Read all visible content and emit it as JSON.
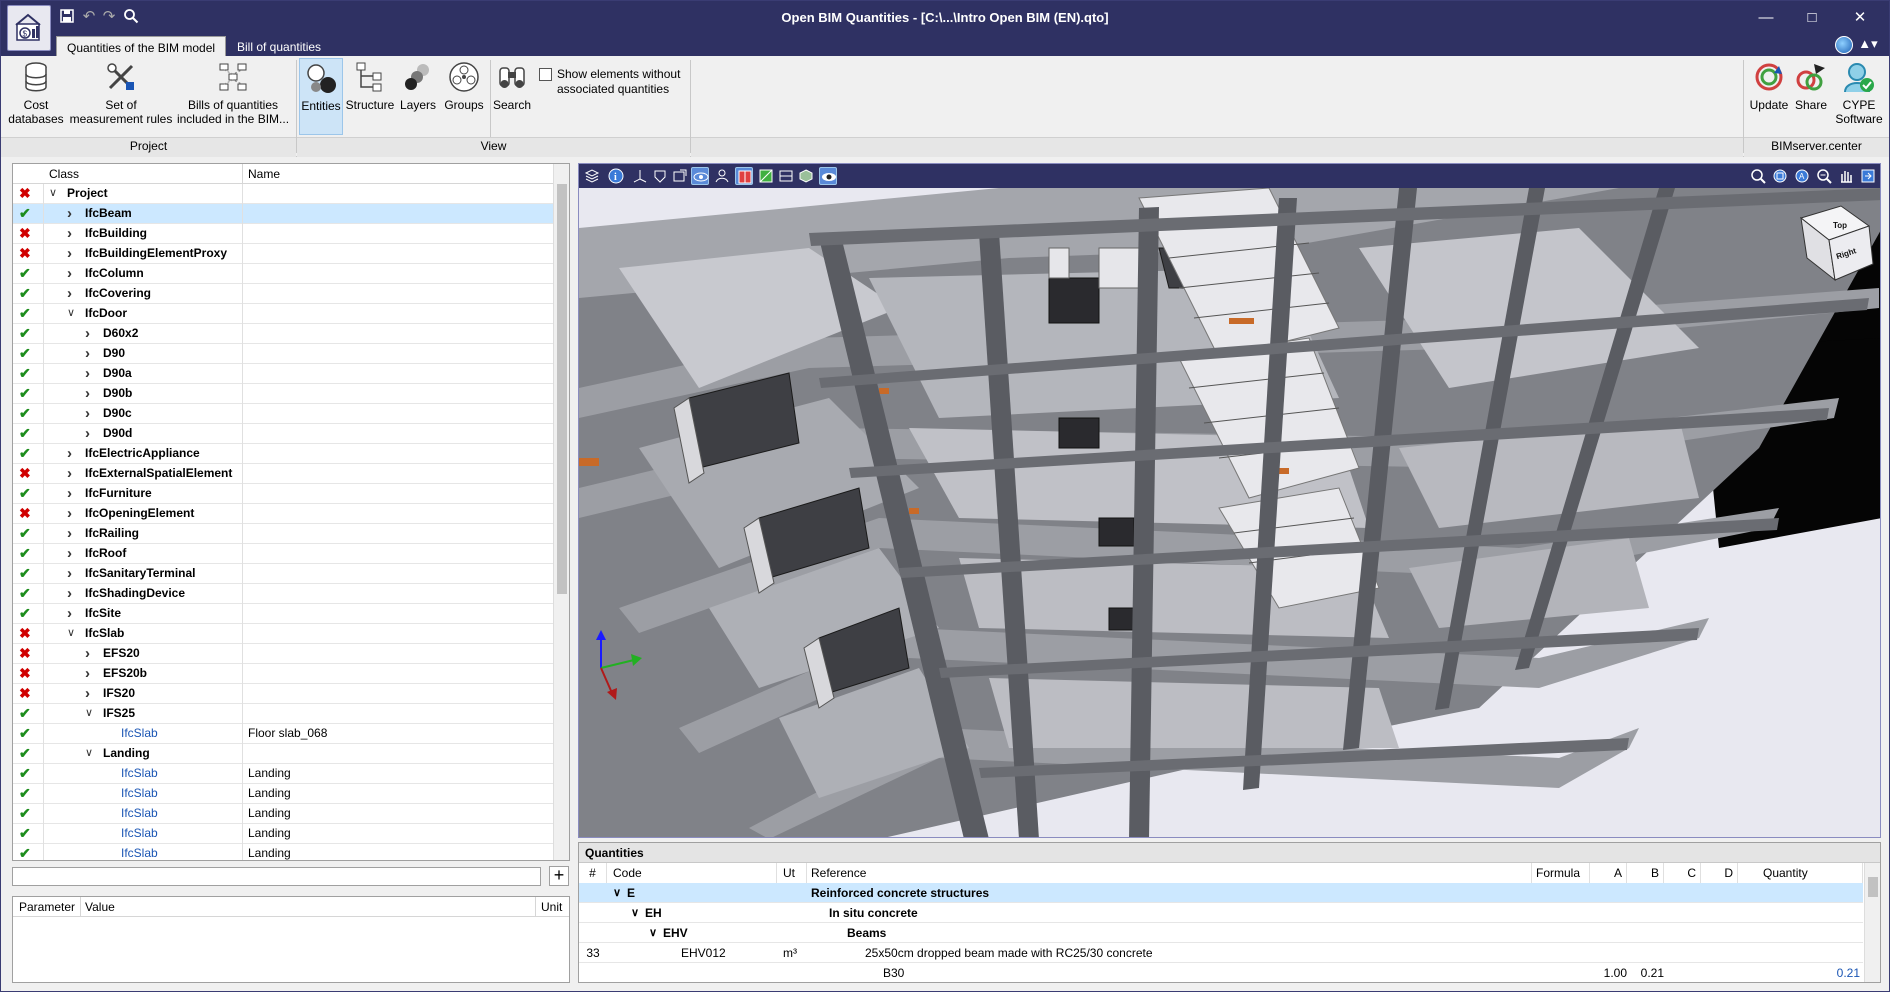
{
  "window": {
    "title": "Open BIM Quantities - [C:\\...\\Intro Open BIM (EN).qto]"
  },
  "tabs": [
    {
      "label": "Quantities of the BIM model"
    },
    {
      "label": "Bill of quantities"
    }
  ],
  "ribbon": {
    "project": {
      "group_label": "Project",
      "cost_databases": "Cost databases",
      "measurement_rules": "Set of measurement rules",
      "bills_included": "Bills of quantities included in the BIM..."
    },
    "view": {
      "group_label": "View",
      "entities": "Entities",
      "structure": "Structure",
      "layers": "Layers",
      "groups": "Groups",
      "search": "Search",
      "show_elements": "Show elements without associated quantities"
    },
    "bimserver": {
      "group_label": "BIMserver.center",
      "update": "Update",
      "share": "Share",
      "cype": "CYPE Software"
    }
  },
  "tree": {
    "col_class": "Class",
    "col_name": "Name",
    "rows": [
      {
        "status": "no",
        "level": 0,
        "expand": "open",
        "label": "Project",
        "name": "",
        "leaf": false
      },
      {
        "status": "ok",
        "level": 1,
        "expand": "closed",
        "label": "IfcBeam",
        "name": "",
        "leaf": false,
        "selected": true
      },
      {
        "status": "no",
        "level": 1,
        "expand": "closed",
        "label": "IfcBuilding",
        "name": "",
        "leaf": false
      },
      {
        "status": "no",
        "level": 1,
        "expand": "closed",
        "label": "IfcBuildingElementProxy",
        "name": "",
        "leaf": false
      },
      {
        "status": "ok",
        "level": 1,
        "expand": "closed",
        "label": "IfcColumn",
        "name": "",
        "leaf": false
      },
      {
        "status": "ok",
        "level": 1,
        "expand": "closed",
        "label": "IfcCovering",
        "name": "",
        "leaf": false
      },
      {
        "status": "ok",
        "level": 1,
        "expand": "open",
        "label": "IfcDoor",
        "name": "",
        "leaf": false
      },
      {
        "status": "ok",
        "level": 2,
        "expand": "closed",
        "label": "D60x2",
        "name": "",
        "leaf": false
      },
      {
        "status": "ok",
        "level": 2,
        "expand": "closed",
        "label": "D90",
        "name": "",
        "leaf": false
      },
      {
        "status": "ok",
        "level": 2,
        "expand": "closed",
        "label": "D90a",
        "name": "",
        "leaf": false
      },
      {
        "status": "ok",
        "level": 2,
        "expand": "closed",
        "label": "D90b",
        "name": "",
        "leaf": false
      },
      {
        "status": "ok",
        "level": 2,
        "expand": "closed",
        "label": "D90c",
        "name": "",
        "leaf": false
      },
      {
        "status": "ok",
        "level": 2,
        "expand": "closed",
        "label": "D90d",
        "name": "",
        "leaf": false
      },
      {
        "status": "ok",
        "level": 1,
        "expand": "closed",
        "label": "IfcElectricAppliance",
        "name": "",
        "leaf": false
      },
      {
        "status": "no",
        "level": 1,
        "expand": "closed",
        "label": "IfcExternalSpatialElement",
        "name": "",
        "leaf": false
      },
      {
        "status": "ok",
        "level": 1,
        "expand": "closed",
        "label": "IfcFurniture",
        "name": "",
        "leaf": false
      },
      {
        "status": "no",
        "level": 1,
        "expand": "closed",
        "label": "IfcOpeningElement",
        "name": "",
        "leaf": false
      },
      {
        "status": "ok",
        "level": 1,
        "expand": "closed",
        "label": "IfcRailing",
        "name": "",
        "leaf": false
      },
      {
        "status": "ok",
        "level": 1,
        "expand": "closed",
        "label": "IfcRoof",
        "name": "",
        "leaf": false
      },
      {
        "status": "ok",
        "level": 1,
        "expand": "closed",
        "label": "IfcSanitaryTerminal",
        "name": "",
        "leaf": false
      },
      {
        "status": "ok",
        "level": 1,
        "expand": "closed",
        "label": "IfcShadingDevice",
        "name": "",
        "leaf": false
      },
      {
        "status": "ok",
        "level": 1,
        "expand": "closed",
        "label": "IfcSite",
        "name": "",
        "leaf": false
      },
      {
        "status": "no",
        "level": 1,
        "expand": "open",
        "label": "IfcSlab",
        "name": "",
        "leaf": false
      },
      {
        "status": "no",
        "level": 2,
        "expand": "closed",
        "label": "EFS20",
        "name": "",
        "leaf": false
      },
      {
        "status": "no",
        "level": 2,
        "expand": "closed",
        "label": "EFS20b",
        "name": "",
        "leaf": false
      },
      {
        "status": "no",
        "level": 2,
        "expand": "closed",
        "label": "IFS20",
        "name": "",
        "leaf": false
      },
      {
        "status": "ok",
        "level": 2,
        "expand": "open",
        "label": "IFS25",
        "name": "",
        "leaf": false
      },
      {
        "status": "ok",
        "level": 3,
        "expand": "none",
        "label": "IfcSlab",
        "name": "Floor slab_068",
        "leaf": true
      },
      {
        "status": "ok",
        "level": 2,
        "expand": "open",
        "label": "Landing",
        "name": "",
        "leaf": false
      },
      {
        "status": "ok",
        "level": 3,
        "expand": "none",
        "label": "IfcSlab",
        "name": "Landing",
        "leaf": true
      },
      {
        "status": "ok",
        "level": 3,
        "expand": "none",
        "label": "IfcSlab",
        "name": "Landing",
        "leaf": true
      },
      {
        "status": "ok",
        "level": 3,
        "expand": "none",
        "label": "IfcSlab",
        "name": "Landing",
        "leaf": true
      },
      {
        "status": "ok",
        "level": 3,
        "expand": "none",
        "label": "IfcSlab",
        "name": "Landing",
        "leaf": true
      },
      {
        "status": "ok",
        "level": 3,
        "expand": "none",
        "label": "IfcSlab",
        "name": "Landing",
        "leaf": true
      }
    ]
  },
  "params": {
    "col_parameter": "Parameter",
    "col_value": "Value",
    "col_unit": "Unit"
  },
  "viewer": {
    "navcube_top": "Top",
    "navcube_face": "Right"
  },
  "quantities": {
    "title": "Quantities",
    "columns": {
      "num": "#",
      "code": "Code",
      "ut": "Ut",
      "reference": "Reference",
      "formula": "Formula",
      "a": "A",
      "b": "B",
      "c": "C",
      "d": "D",
      "quantity": "Quantity"
    },
    "rows": [
      {
        "num": "",
        "code": "E",
        "ut": "",
        "reference": "Reinforced concrete structures",
        "a": "",
        "b": "",
        "quantity": "",
        "indent": 0,
        "bold": true,
        "selected": true,
        "expand": true
      },
      {
        "num": "",
        "code": "EH",
        "ut": "",
        "reference": "In situ concrete",
        "a": "",
        "b": "",
        "quantity": "",
        "indent": 1,
        "bold": true,
        "expand": true
      },
      {
        "num": "",
        "code": "EHV",
        "ut": "",
        "reference": "Beams",
        "a": "",
        "b": "",
        "quantity": "",
        "indent": 2,
        "bold": true,
        "expand": true
      },
      {
        "num": "33",
        "code": "EHV012",
        "ut": "m³",
        "reference": "25x50cm dropped beam made with RC25/30 concrete",
        "a": "",
        "b": "",
        "quantity": "",
        "indent": 3,
        "bold": false
      },
      {
        "num": "",
        "code": "",
        "ut": "",
        "reference": "B30",
        "a": "1.00",
        "b": "0.21",
        "quantity": "0.21",
        "indent": 4,
        "bold": false
      }
    ]
  },
  "colors": {
    "titlebar": "#2f3163",
    "accent": "#1a55b4",
    "ok": "#1c8c1c",
    "error": "#d00000"
  }
}
